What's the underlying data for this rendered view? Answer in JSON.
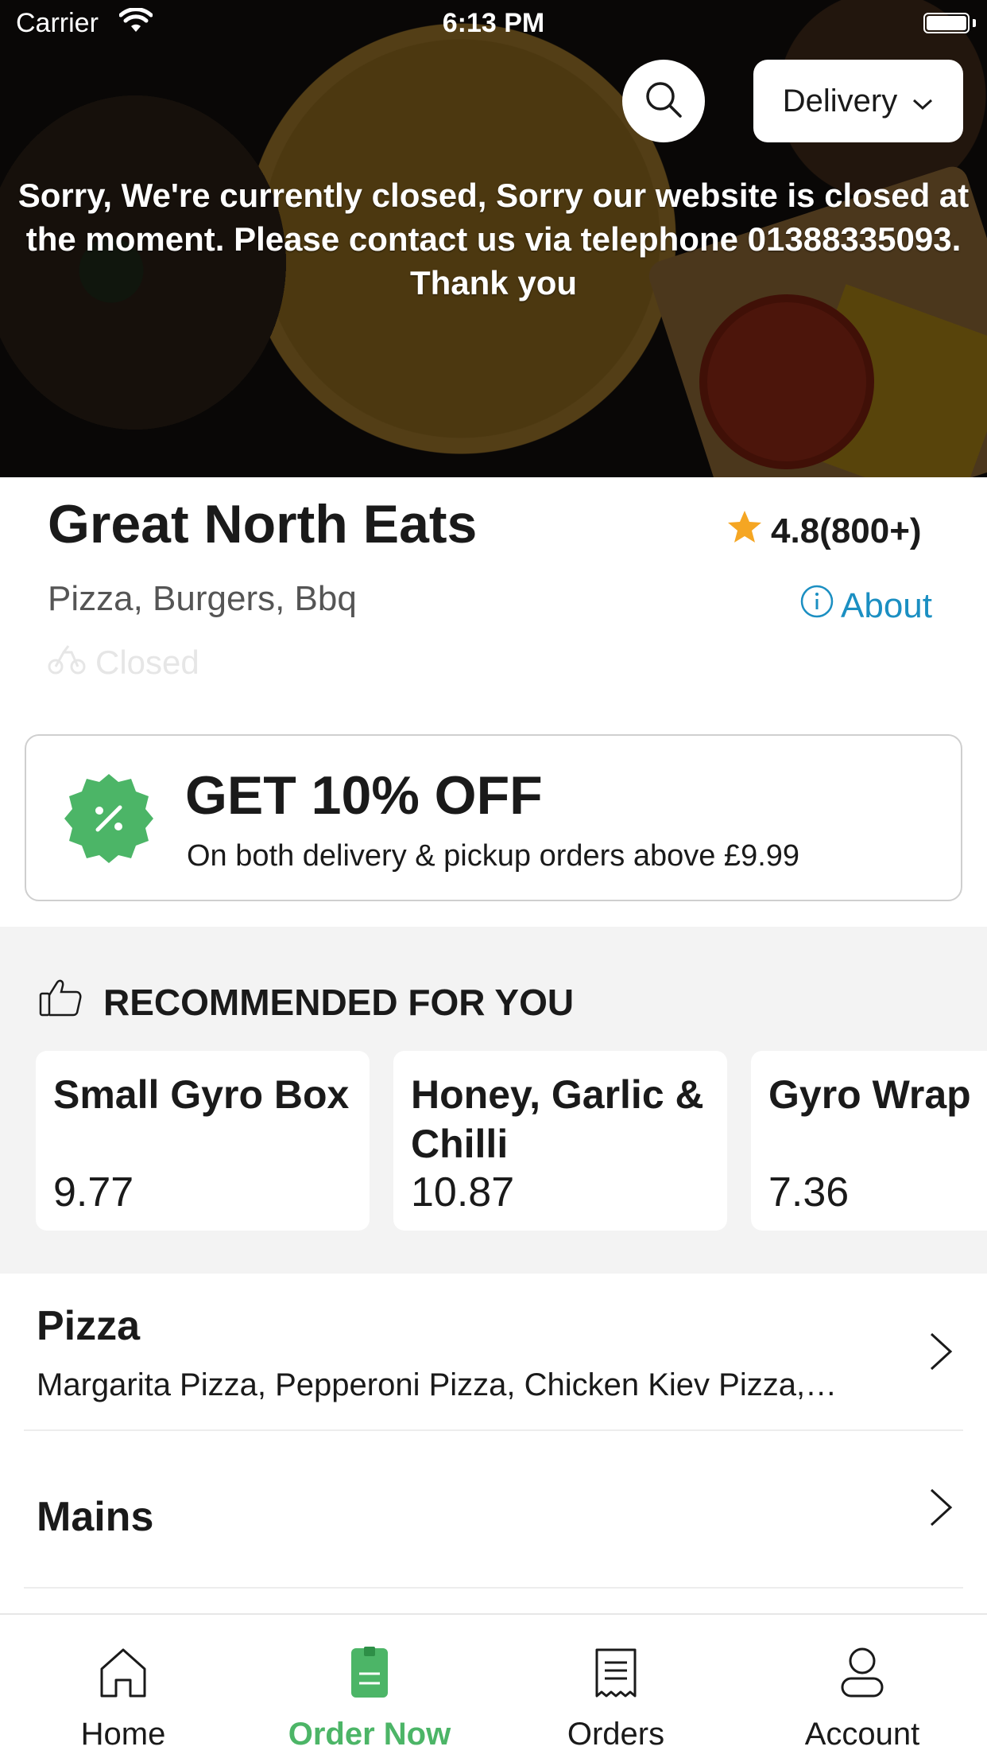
{
  "status_bar": {
    "carrier": "Carrier",
    "time": "6:13 PM"
  },
  "hero": {
    "delivery_mode": "Delivery",
    "closed_message": "Sorry, We're currently closed, Sorry our website is closed at the moment. Please contact us via telephone 01388335093. Thank you"
  },
  "restaurant": {
    "name": "Great North Eats",
    "rating": "4.8(800+)",
    "cuisine": "Pizza, Burgers, Bbq",
    "about_label": "About",
    "status": "Closed"
  },
  "offer": {
    "title": "GET 10% OFF",
    "subtitle": "On both delivery & pickup orders above £9.99"
  },
  "recommended": {
    "heading": "RECOMMENDED FOR YOU",
    "items": [
      {
        "name": "Small Gyro Box",
        "price": "9.77"
      },
      {
        "name": "Honey, Garlic & Chilli Chicken…",
        "price": "10.87"
      },
      {
        "name": "Gyro Wrap",
        "price": "7.36"
      }
    ]
  },
  "categories": [
    {
      "title": "Pizza",
      "items": "Margarita Pizza, Pepperoni Pizza, Chicken Kiev Pizza,…"
    },
    {
      "title": "Mains",
      "items": ""
    }
  ],
  "tabs": [
    {
      "label": "Home",
      "icon": "home-icon"
    },
    {
      "label": "Order Now",
      "icon": "order-icon"
    },
    {
      "label": "Orders",
      "icon": "receipt-icon"
    },
    {
      "label": "Account",
      "icon": "user-icon"
    }
  ],
  "colors": {
    "accent_green": "#4cb567",
    "link_blue": "#1b8fc2",
    "star": "#f5a623"
  }
}
